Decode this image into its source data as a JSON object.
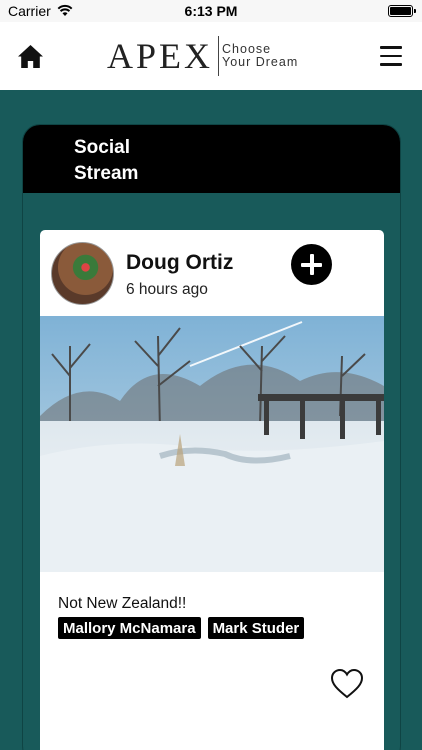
{
  "status_bar": {
    "carrier": "Carrier",
    "time": "6:13 PM",
    "icons": [
      "wifi-icon",
      "battery-icon"
    ]
  },
  "navbar": {
    "logo_word": "APEX",
    "logo_tagline_line1": "Choose",
    "logo_tagline_line2": "Your Dream",
    "left_icon": "home-icon",
    "right_icon": "menu-icon"
  },
  "stream": {
    "title_line1": "Social",
    "title_line2": "Stream"
  },
  "post": {
    "author": "Doug Ortiz",
    "time_ago": "6 hours ago",
    "caption": "Not New Zealand!!",
    "tags": [
      "Mallory McNamara",
      "Mark Studer"
    ],
    "action_icons": [
      "add-icon",
      "heart-icon"
    ]
  },
  "colors": {
    "background": "#185a5a",
    "header": "#000000",
    "card": "#ffffff"
  }
}
